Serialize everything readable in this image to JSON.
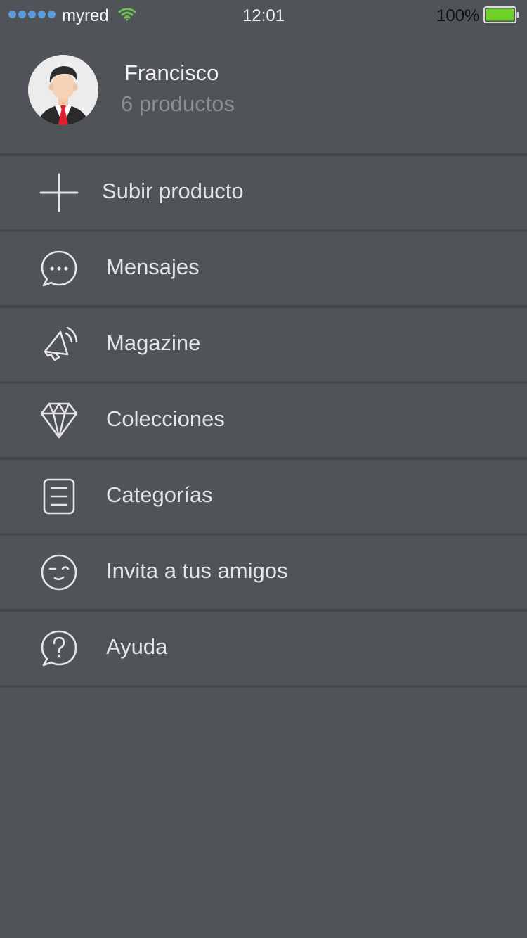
{
  "status_bar": {
    "carrier": "myred",
    "time": "12:01",
    "battery": "100%",
    "signal_icon": "signal-dots-icon",
    "wifi_icon": "wifi-icon",
    "battery_icon": "battery-icon"
  },
  "profile": {
    "name": "Francisco",
    "count": "6 productos",
    "avatar_icon": "avatar-icon"
  },
  "menu": {
    "items": [
      {
        "label": "Subir producto",
        "icon": "plus-icon"
      },
      {
        "label": "Mensajes",
        "icon": "chat-bubble-icon"
      },
      {
        "label": "Magazine",
        "icon": "megaphone-icon"
      },
      {
        "label": "Colecciones",
        "icon": "diamond-icon"
      },
      {
        "label": "Categorías",
        "icon": "list-icon"
      },
      {
        "label": "Invita a tus amigos",
        "icon": "wink-face-icon"
      },
      {
        "label": "Ayuda",
        "icon": "help-bubble-icon"
      }
    ]
  },
  "colors": {
    "background": "#505357",
    "divider": "#44474b",
    "text": "#e4e5e6",
    "muted_text": "#8b8f94",
    "battery_fill": "#6fd027",
    "signal_dots": "#5b9bdd",
    "wifi": "#6cc24a"
  }
}
